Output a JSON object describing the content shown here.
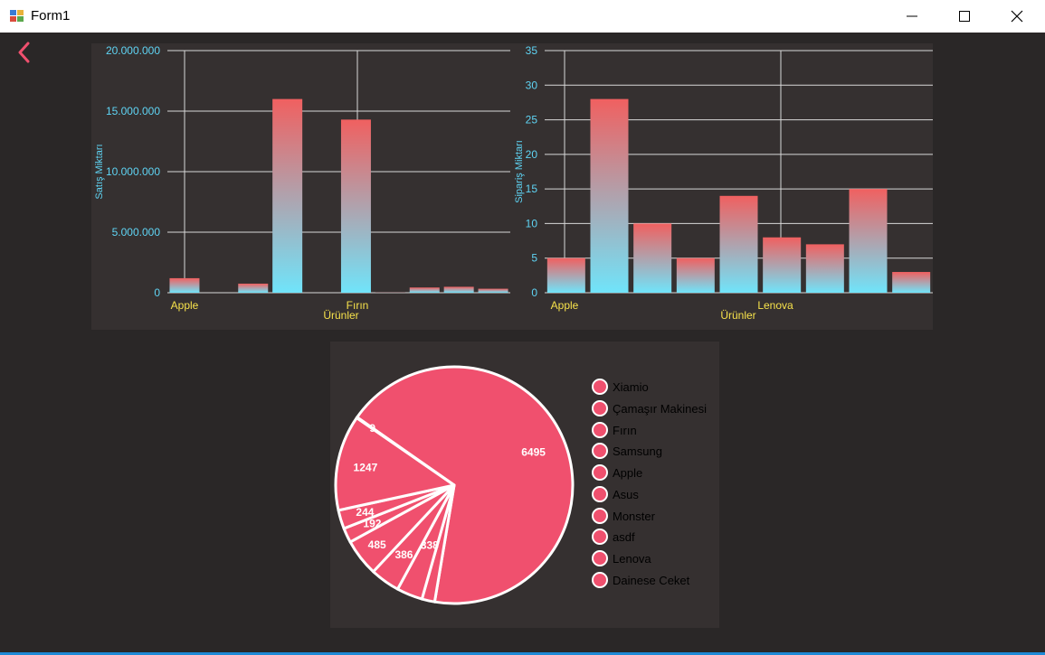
{
  "window": {
    "title": "Form1"
  },
  "colors": {
    "bar_top": "#f06060",
    "bar_bottom": "#70e4fa",
    "axis_text": "#5fd4f4",
    "category_text": "#f7e24b",
    "pie": "#f0506e"
  },
  "chart_data": [
    {
      "type": "bar",
      "ylabel": "Satış Miktarı",
      "xlabel": "Ürünler",
      "ylim": [
        0,
        20000000
      ],
      "yticks": [
        "0",
        "5.000.000",
        "10.000.000",
        "15.000.000",
        "20.000.000"
      ],
      "visible_category_labels": [
        "Apple",
        "Fırın"
      ],
      "values": [
        1200000,
        0,
        750000,
        16000000,
        0,
        14300000,
        30000,
        430000,
        490000,
        330000
      ]
    },
    {
      "type": "bar",
      "ylabel": "Sipariş Miktarı",
      "xlabel": "Ürünler",
      "ylim": [
        0,
        35
      ],
      "yticks": [
        "0",
        "5",
        "10",
        "15",
        "20",
        "25",
        "30",
        "35"
      ],
      "visible_category_labels": [
        "Apple",
        "Lenova"
      ],
      "values": [
        5,
        28,
        10,
        5,
        14,
        8,
        7,
        15,
        3
      ]
    },
    {
      "type": "pie",
      "legend": [
        "Xiamio",
        "Çamaşır Makinesi",
        "Fırın",
        "Samsung",
        "Apple",
        "Asus",
        "Monster",
        "asdf",
        "Lenova",
        "Dainese Ceket"
      ],
      "values": [
        6495,
        167,
        338,
        386,
        485,
        192,
        244,
        1247,
        9
      ],
      "value_labels": [
        "6495",
        "",
        "338",
        "386",
        "485",
        "192",
        "244",
        "1247",
        "9"
      ]
    }
  ]
}
